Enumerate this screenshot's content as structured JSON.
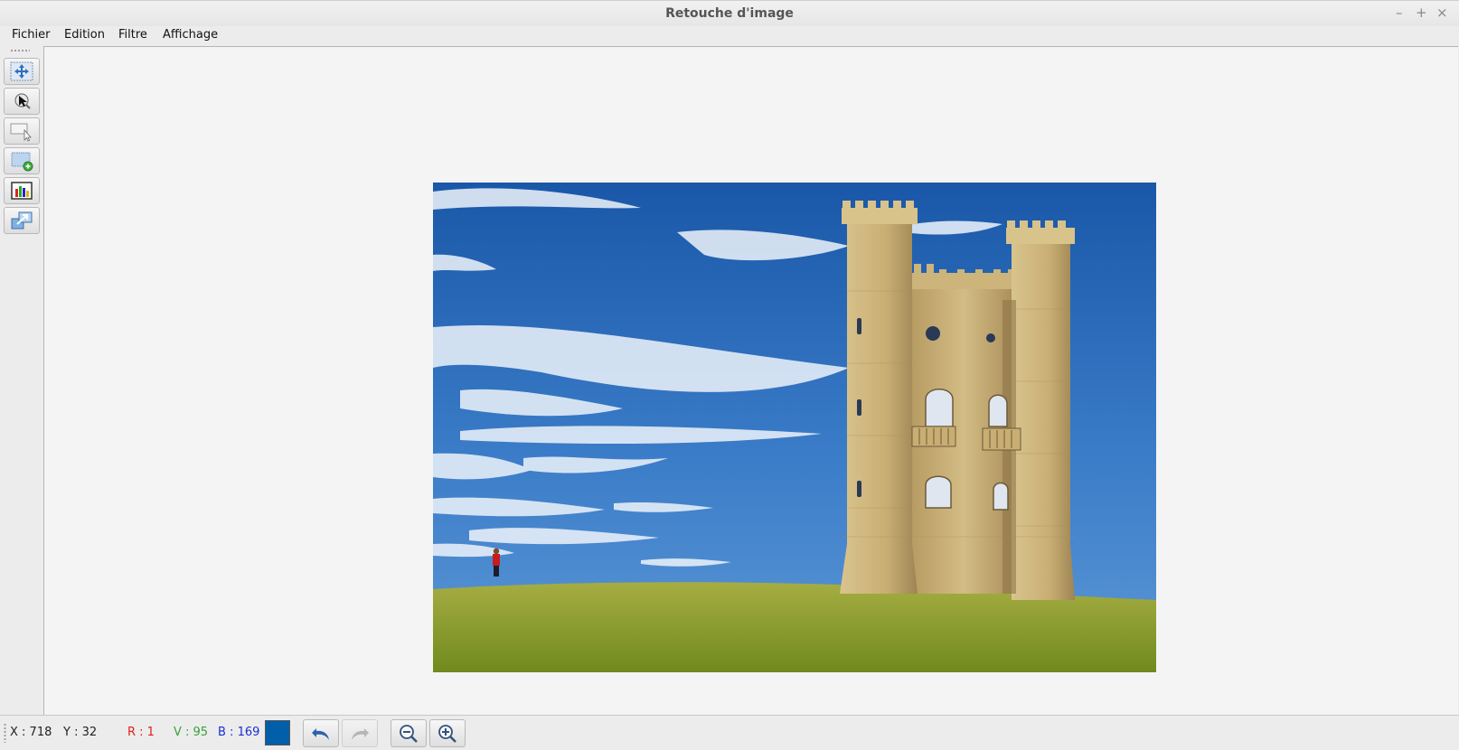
{
  "window": {
    "title": "Retouche d'image",
    "minimize": "–",
    "maximize": "+",
    "close": "×"
  },
  "menu": [
    {
      "label": "Fichier"
    },
    {
      "label": "Edition"
    },
    {
      "label": "Filtre"
    },
    {
      "label": "Affichage"
    }
  ],
  "toolbar": {
    "tools": [
      {
        "name": "move-tool",
        "icon": "move-arrows-icon"
      },
      {
        "name": "pointer-tool",
        "icon": "cursor-magnifier-icon"
      },
      {
        "name": "rect-select-tool",
        "icon": "selection-cursor-icon"
      },
      {
        "name": "new-layer-tool",
        "icon": "new-layer-plus-icon"
      },
      {
        "name": "histogram-tool",
        "icon": "histogram-icon"
      },
      {
        "name": "resize-tool",
        "icon": "resize-layers-icon"
      }
    ]
  },
  "status": {
    "x": "X : 718",
    "y": "Y : 32",
    "r": "R : 1",
    "v": "V : 95",
    "b": "B : 169",
    "colors": {
      "r_text": "#e02020",
      "v_text": "#3aa03a",
      "b_text": "#1a2fd0",
      "swatch": "#015fa9"
    },
    "buttons": [
      {
        "name": "undo-button",
        "icon": "undo-icon",
        "enabled": true
      },
      {
        "name": "redo-button",
        "icon": "redo-icon",
        "enabled": false
      },
      {
        "name": "zoom-out-button",
        "icon": "zoom-out-icon",
        "enabled": true
      },
      {
        "name": "zoom-in-button",
        "icon": "zoom-in-icon",
        "enabled": true
      }
    ]
  },
  "image": {
    "subject": "tower-photo"
  }
}
